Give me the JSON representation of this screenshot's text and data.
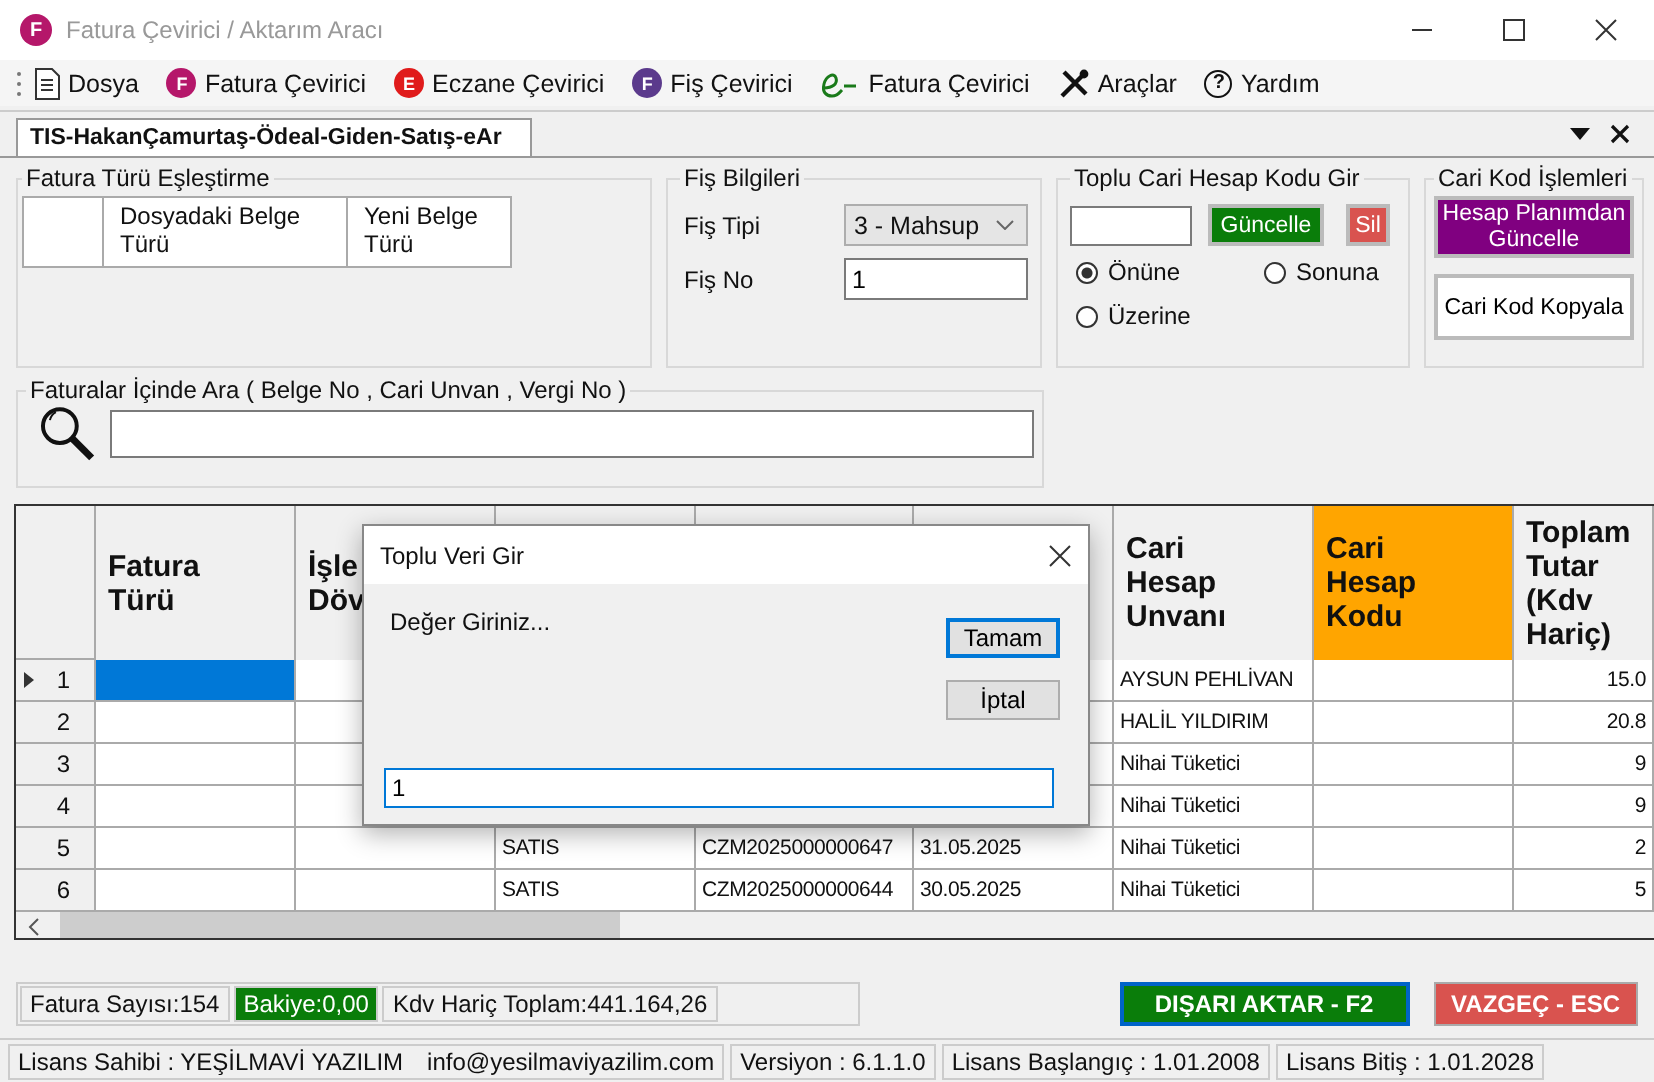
{
  "window": {
    "icon_letter": "F",
    "title": "Fatura Çevirici / Aktarım Aracı"
  },
  "menu": [
    {
      "kind": "doc",
      "label": "Dosya"
    },
    {
      "kind": "badge",
      "badge": "F",
      "color": "#b5176a",
      "label": "Fatura Çevirici"
    },
    {
      "kind": "badge",
      "badge": "E",
      "color": "#e01b1b",
      "label": "Eczane Çevirici"
    },
    {
      "kind": "badge",
      "badge": "F",
      "color": "#5b3a8c",
      "label": "Fiş Çevirici"
    },
    {
      "kind": "efatura",
      "label": "Fatura Çevirici"
    },
    {
      "kind": "tools",
      "label": "Araçlar"
    },
    {
      "kind": "help",
      "badge": "?",
      "label": "Yardım"
    }
  ],
  "tabs": [
    {
      "label": "TIS-HakanÇamurtaş-Ödeal-Giden-Satış-eAr",
      "selected": true
    }
  ],
  "matching": {
    "title": "Fatura Türü Eşleştirme",
    "columns": [
      "Dosyadaki Belge Türü",
      "Yeni Belge Türü"
    ]
  },
  "fis": {
    "title": "Fiş Bilgileri",
    "type_label": "Fiş Tipi",
    "type_value": "3 - Mahsup",
    "no_label": "Fiş No",
    "no_value": "1"
  },
  "bulk_code": {
    "title": "Toplu Cari Hesap Kodu Gir",
    "update_button": "Güncelle",
    "delete_button": "Sil",
    "options": [
      {
        "label": "Önüne",
        "selected": true
      },
      {
        "label": "Sonuna",
        "selected": false
      },
      {
        "label": "Üzerine",
        "selected": false
      }
    ]
  },
  "code_ops": {
    "title": "Cari Kod İşlemleri",
    "buttons": [
      "Hesap Planımdan Güncelle",
      "Cari Kod Kopyala"
    ]
  },
  "search": {
    "title": "Faturalar İçinde Ara ( Belge No , Cari Unvan , Vergi No )"
  },
  "grid": {
    "columns": [
      {
        "label": "Fatura\nTürü",
        "highlight": false
      },
      {
        "label": "İşle\nDöv",
        "highlight": false
      },
      {
        "highlight": false
      },
      {
        "highlight": false
      },
      {
        "highlight": false
      },
      {
        "label": "Cari\nHesap\nUnvanı",
        "highlight": false
      },
      {
        "label": "Cari\nHesap\nKodu",
        "highlight": true
      },
      {
        "label": "Toplam\nTutar\n(Kdv\nHariç)",
        "highlight": false
      }
    ],
    "rows": [
      {
        "num": "1",
        "selected": true,
        "cells": [
          null,
          null,
          null,
          null,
          null,
          "AYSUN PEHLİVAN",
          null,
          "15.0"
        ]
      },
      {
        "num": "2",
        "selected": false,
        "cells": [
          null,
          null,
          null,
          null,
          null,
          "HALİL YILDIRIM",
          null,
          "20.8"
        ]
      },
      {
        "num": "3",
        "selected": false,
        "cells": [
          null,
          null,
          null,
          null,
          null,
          "Nihai Tüketici",
          null,
          "9"
        ]
      },
      {
        "num": "4",
        "selected": false,
        "cells": [
          null,
          null,
          null,
          null,
          null,
          "Nihai Tüketici",
          null,
          "9"
        ]
      },
      {
        "num": "5",
        "selected": false,
        "cells": [
          null,
          null,
          "SATIS",
          "CZM2025000000647",
          "31.05.2025",
          "Nihai Tüketici",
          null,
          "2"
        ]
      },
      {
        "num": "6",
        "selected": false,
        "cells": [
          null,
          null,
          "SATIS",
          "CZM2025000000644",
          "30.05.2025",
          "Nihai Tüketici",
          null,
          "5"
        ]
      }
    ]
  },
  "dialog": {
    "title": "Toplu Veri Gir",
    "message": "Değer Giriniz...",
    "buttons": [
      {
        "label": "Tamam",
        "focused": true
      },
      {
        "label": "İptal",
        "focused": false
      }
    ],
    "value": "1"
  },
  "summary": [
    {
      "kind": "plain",
      "text": "Fatura Sayısı:154"
    },
    {
      "kind": "balance",
      "text": "Bakiye:0,00"
    },
    {
      "kind": "plain",
      "text": "Kdv Hariç Toplam:441.164,26"
    }
  ],
  "actions": [
    {
      "kind": "export",
      "label": "DIŞARI AKTAR - F2"
    },
    {
      "kind": "cancel",
      "label": "VAZGEÇ - ESC"
    }
  ],
  "status_bar": [
    {
      "parts": [
        "Lisans Sahibi : YEŞİLMAVİ YAZILIM",
        "info@yesilmaviyazilim.com"
      ]
    },
    {
      "parts": [
        "Versiyon : 6.1.1.0"
      ]
    },
    {
      "parts": [
        "Lisans Başlangıç : 1.01.2008"
      ]
    },
    {
      "parts": [
        "Lisans Bitiş : 1.01.2028"
      ]
    }
  ]
}
